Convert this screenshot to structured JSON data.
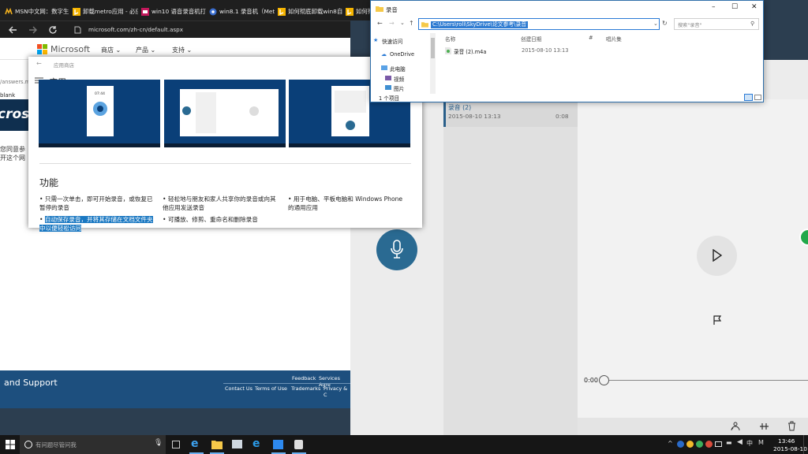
{
  "browser": {
    "tabs": [
      {
        "label": "MSN中文网：数字生"
      },
      {
        "label": "卸载metro应用 - 必应"
      },
      {
        "label": "win10 语音录音机打"
      },
      {
        "label": "win8.1 录音机（Metr"
      },
      {
        "label": "如何彻底卸载win8自"
      },
      {
        "label": "如何彻"
      }
    ],
    "url": "microsoft.com/zh-cn/default.aspx",
    "brand": "Microsoft",
    "nav": [
      "商店",
      "产品",
      "支持"
    ],
    "answers_url": "/answers.m",
    "blank_text": "blank",
    "bluebar_text": "cros",
    "agree_line1": "您同意参",
    "agree_line2": "开这个网",
    "footer": {
      "title": "and Support",
      "row1": [
        "Feedback",
        "Services Agre"
      ],
      "row2": [
        "Contact Us",
        "Terms of Use",
        "Trademarks",
        "Privacy & C"
      ]
    }
  },
  "store": {
    "breadcrumb": "应用商店",
    "title": "应用",
    "features_title": "功能",
    "features": [
      "只需一次单击，即可开始录音，或恢复已暂停的录音",
      "自动保存录音，并将其存储在文档文件夹中以便轻松访问",
      "轻松地与朋友和家人共享你的录音或向其他应用发送录音",
      "可播放、修剪、重命名和删除录音",
      "用于电脑、平板电脑和 Windows Phone 的通用应用"
    ],
    "screenshot_times": [
      "07:44"
    ]
  },
  "recorder": {
    "item_name": "录音 (2)",
    "item_date": "2015-08-10 13:13",
    "item_duration": "0:08",
    "time": "0:00"
  },
  "explorer": {
    "title": "录音",
    "address_path": "C:\\Users\\roli\\SkyDrive\\论文参考\\录音",
    "search_placeholder": "搜索\"录音\"",
    "nav_items": [
      "快速访问",
      "OneDrive",
      "此电脑",
      "视频",
      "图片"
    ],
    "columns": [
      "名称",
      "创建日期",
      "#",
      "唱片集"
    ],
    "file": {
      "name": "录音 (2).m4a",
      "created": "2015-08-10 13:13"
    },
    "status": "1 个项目"
  },
  "taskbar": {
    "search_placeholder": "有问题尽管问我",
    "time": "13:46",
    "date": "2015-08-10"
  },
  "colors": {
    "accent": "#1a78c2",
    "recorder_blue": "#2a6a92",
    "store_blue": "#0a3f78"
  }
}
